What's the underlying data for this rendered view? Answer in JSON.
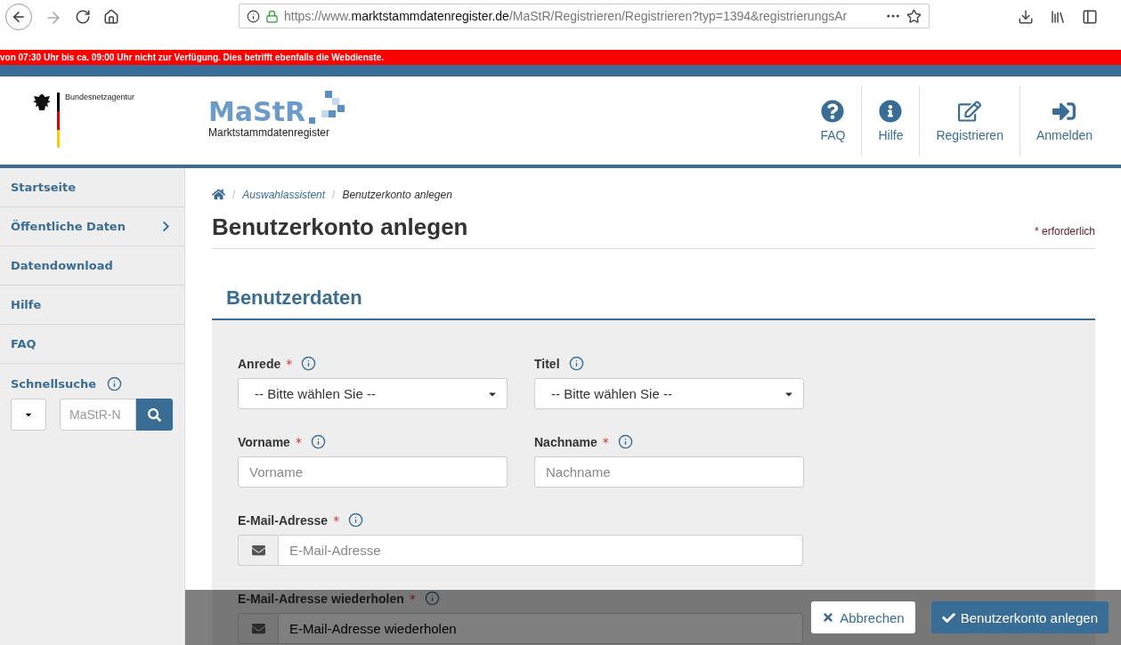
{
  "browser": {
    "url_parts": [
      {
        "text": "https://www.",
        "strong": false
      },
      {
        "text": "marktstammdatenregister.de",
        "strong": true
      },
      {
        "text": "/MaStR/Registrieren/Registrieren?typ=1394&registrierungsAr",
        "strong": false
      }
    ]
  },
  "banner": {
    "text": "von 07:30 Uhr bis ca. 09:00 Uhr nicht zur Verfügung. Dies betrifft ebenfalls die Webdienste."
  },
  "header": {
    "agency": "Bundesnetzagentur",
    "logo_text": "MaStR",
    "logo_subtitle": "Marktstammdatenregister",
    "nav": [
      {
        "kind": "faq",
        "label": "FAQ"
      },
      {
        "kind": "help",
        "label": "Hilfe"
      },
      {
        "kind": "register",
        "label": "Registrieren"
      },
      {
        "kind": "login",
        "label": "Anmelden"
      }
    ]
  },
  "sidebar": {
    "items": [
      {
        "label": "Startseite",
        "expandable": false
      },
      {
        "label": "Öffentliche Daten",
        "expandable": true
      },
      {
        "label": "Datendownload",
        "expandable": false
      },
      {
        "label": "Hilfe",
        "expandable": false
      },
      {
        "label": "FAQ",
        "expandable": false
      }
    ],
    "quick_search": {
      "label": "Schnellsuche",
      "placeholder": "MaStR-N"
    }
  },
  "breadcrumb": {
    "separator": "/",
    "items": [
      "Auswahlassistent",
      "Benutzerkonto anlegen"
    ]
  },
  "page_title": "Benutzerkonto anlegen",
  "required_note": "* erforderlich",
  "section_title": "Benutzerdaten",
  "required_mark": "*",
  "rows": [
    {
      "fields": [
        {
          "label": "Anrede",
          "required": true,
          "kind": "select",
          "value": "-- Bitte wählen Sie --"
        },
        {
          "label": "Titel",
          "required": false,
          "kind": "select",
          "value": "-- Bitte wählen Sie --"
        }
      ]
    },
    {
      "fields": [
        {
          "label": "Vorname",
          "required": true,
          "kind": "text",
          "placeholder": "Vorname"
        },
        {
          "label": "Nachname",
          "required": true,
          "kind": "text",
          "placeholder": "Nachname"
        }
      ]
    },
    {
      "fields": [
        {
          "label": "E-Mail-Adresse",
          "required": true,
          "kind": "email",
          "placeholder": "E-Mail-Adresse"
        }
      ]
    },
    {
      "fields": [
        {
          "label": "E-Mail-Adresse wiederholen",
          "required": true,
          "kind": "email",
          "placeholder": "E-Mail-Adresse wiederholen"
        }
      ]
    }
  ],
  "actions": [
    {
      "kind": "cancel",
      "label": "Abbrechen"
    },
    {
      "kind": "submit",
      "label": "Benutzerkonto anlegen"
    }
  ]
}
